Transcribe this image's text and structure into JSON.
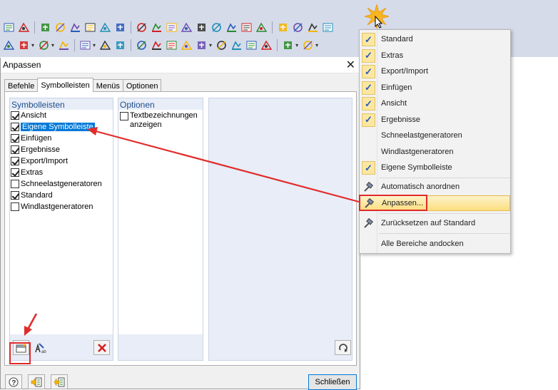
{
  "dialog": {
    "title": "Anpassen",
    "close_glyph": "✕",
    "tabs": [
      {
        "label": "Befehle",
        "active": false
      },
      {
        "label": "Symbolleisten",
        "active": true
      },
      {
        "label": "Menüs",
        "active": false
      },
      {
        "label": "Optionen",
        "active": false
      }
    ],
    "toolbars_header": "Symbolleisten",
    "toolbars": [
      {
        "label": "Ansicht",
        "checked": true,
        "selected": false
      },
      {
        "label": "Eigene Symbolleiste",
        "checked": true,
        "selected": true
      },
      {
        "label": "Einfügen",
        "checked": true,
        "selected": false
      },
      {
        "label": "Ergebnisse",
        "checked": true,
        "selected": false
      },
      {
        "label": "Export/Import",
        "checked": true,
        "selected": false
      },
      {
        "label": "Extras",
        "checked": true,
        "selected": false
      },
      {
        "label": "Schneelastgeneratoren",
        "checked": false,
        "selected": false
      },
      {
        "label": "Standard",
        "checked": true,
        "selected": false
      },
      {
        "label": "Windlastgeneratoren",
        "checked": false,
        "selected": false
      }
    ],
    "options_header": "Optionen",
    "option_text_labels": {
      "label": "Textbezeichnungen anzeigen",
      "checked": false
    },
    "close_button": "Schließen"
  },
  "context_menu": {
    "toolbar_items": [
      {
        "label": "Standard",
        "checked": true
      },
      {
        "label": "Extras",
        "checked": true
      },
      {
        "label": "Export/Import",
        "checked": true
      },
      {
        "label": "Einfügen",
        "checked": true
      },
      {
        "label": "Ansicht",
        "checked": true
      },
      {
        "label": "Ergebnisse",
        "checked": true
      },
      {
        "label": "Schneelastgeneratoren",
        "checked": false
      },
      {
        "label": "Windlastgeneratoren",
        "checked": false
      },
      {
        "label": "Eigene Symbolleiste",
        "checked": true
      }
    ],
    "auto_arrange": "Automatisch anordnen",
    "customize": "Anpassen...",
    "reset": "Zurücksetzen auf Standard",
    "dock_all": "Alle Bereiche andocken",
    "check_glyph": "✓"
  },
  "colors": {
    "toolbar_bg": "#d6dbe9",
    "selection": "#0078d7",
    "annotation": "#e12b2b",
    "menu_hover": "#fcdf80",
    "column_bg": "#e8edf7"
  }
}
